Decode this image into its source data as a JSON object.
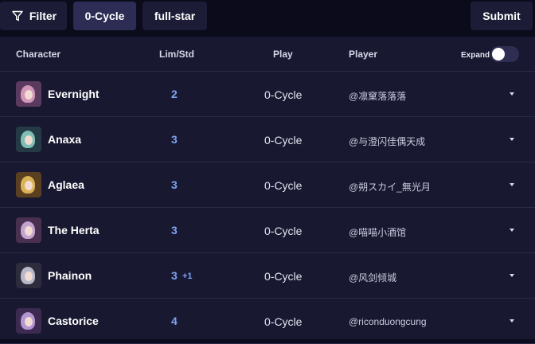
{
  "toolbar": {
    "filter_label": "Filter",
    "filter_icon": "funnel-icon",
    "cycle_label": "0-Cycle",
    "star_label": "full-star",
    "submit_label": "Submit"
  },
  "table": {
    "headers": {
      "character": "Character",
      "lim_std": "Lim/Std",
      "play": "Play",
      "player": "Player",
      "expand": "Expand"
    },
    "expand_on": false,
    "rows": [
      {
        "name": "Evernight",
        "lim": "2",
        "bonus": "",
        "play": "0-Cycle",
        "player": "@凛窠落落落",
        "avatar_colors": [
          "#5a3a5e",
          "#e8a8c8"
        ]
      },
      {
        "name": "Anaxa",
        "lim": "3",
        "bonus": "",
        "play": "0-Cycle",
        "player": "@与澄闪佳偶天成",
        "avatar_colors": [
          "#243a44",
          "#8fd6c8"
        ]
      },
      {
        "name": "Aglaea",
        "lim": "3",
        "bonus": "",
        "play": "0-Cycle",
        "player": "@朔スカイ_無光月",
        "avatar_colors": [
          "#5a4020",
          "#f0c860"
        ]
      },
      {
        "name": "The Herta",
        "lim": "3",
        "bonus": "",
        "play": "0-Cycle",
        "player": "@喵喵小酒馆",
        "avatar_colors": [
          "#4a3050",
          "#d8b8e8"
        ]
      },
      {
        "name": "Phainon",
        "lim": "3",
        "bonus": "+1",
        "play": "0-Cycle",
        "player": "@风剑倾城",
        "avatar_colors": [
          "#2c2c3c",
          "#d0d0e0"
        ]
      },
      {
        "name": "Castorice",
        "lim": "4",
        "bonus": "",
        "play": "0-Cycle",
        "player": "@riconduongcung",
        "avatar_colors": [
          "#3c2a50",
          "#c8a8e8"
        ]
      }
    ]
  }
}
